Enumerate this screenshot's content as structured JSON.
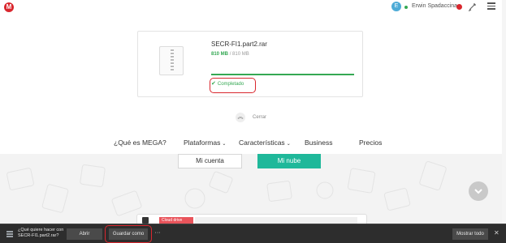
{
  "header": {
    "logo_letter": "M",
    "user_initial": "E",
    "user_name": "Erwin Spadaccina",
    "rocket_icon": "rocket-icon",
    "menu_icon": "hamburger-menu-icon"
  },
  "transfer": {
    "file_name": "SECR-FI1.part2.rar",
    "size_done": "810 MB",
    "size_total": "/ 810 MB",
    "progress_fraction": 1.0,
    "status": "Completado",
    "status_color": "#35a853"
  },
  "close_label": "Cerrar",
  "nav": {
    "what_is": "¿Qué es MEGA?",
    "platforms": "Plataformas",
    "features": "Características",
    "business": "Business",
    "pricing": "Precios"
  },
  "hero": {
    "account_button": "Mi cuenta",
    "cloud_button": "Mi nube",
    "mock_tab": "Cloud drive"
  },
  "download_bar": {
    "question_line1": "¿Qué quiere hacer con",
    "question_line2": "SECR-FI1.part2.rar?",
    "open": "Abrir",
    "save_as": "Guardar como",
    "more": "···",
    "show_all": "Mostrar todo",
    "close": "✕"
  },
  "colors": {
    "brand_red": "#d9272e",
    "accent_green": "#1fb89a",
    "progress_green": "#35a853"
  }
}
